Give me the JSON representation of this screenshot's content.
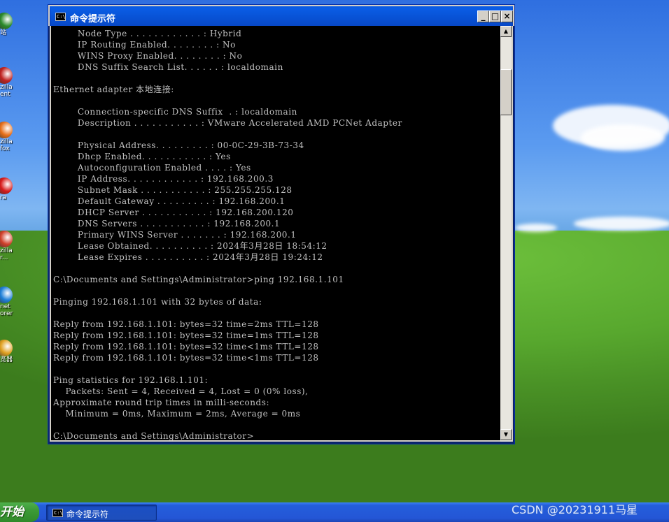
{
  "desktop": {
    "icons": [
      {
        "label": "站",
        "icon": "network-icon",
        "color": "#2a8a2a"
      },
      {
        "label": "zilla\nent",
        "icon": "filezilla-icon",
        "color": "#c0211f"
      },
      {
        "label": "zilla\nfox",
        "icon": "firefox-icon",
        "color": "#e8701a"
      },
      {
        "label": "ra",
        "icon": "opera-icon",
        "color": "#d81b1b"
      },
      {
        "label": "zilla\nr...",
        "icon": "filezilla-server-icon",
        "color": "#d0402a"
      },
      {
        "label": "net\norer",
        "icon": "internet-explorer-icon",
        "color": "#1e7fd8"
      },
      {
        "label": "览器",
        "icon": "chrome-icon",
        "color": "#e0a020"
      }
    ]
  },
  "window": {
    "title": "命令提示符",
    "icon_text": "C:\\",
    "controls": {
      "minimize": "_",
      "maximize": "□",
      "close": "×"
    }
  },
  "console": {
    "lines": [
      "        Node Type . . . . . . . . . . . . : Hybrid",
      "        IP Routing Enabled. . . . . . . . : No",
      "        WINS Proxy Enabled. . . . . . . . : No",
      "        DNS Suffix Search List. . . . . . : localdomain",
      "",
      "Ethernet adapter 本地连接:",
      "",
      "        Connection-specific DNS Suffix  . : localdomain",
      "        Description . . . . . . . . . . . : VMware Accelerated AMD PCNet Adapter",
      "",
      "        Physical Address. . . . . . . . . : 00-0C-29-3B-73-34",
      "        Dhcp Enabled. . . . . . . . . . . : Yes",
      "        Autoconfiguration Enabled . . . . : Yes",
      "        IP Address. . . . . . . . . . . . : 192.168.200.3",
      "        Subnet Mask . . . . . . . . . . . : 255.255.255.128",
      "        Default Gateway . . . . . . . . . : 192.168.200.1",
      "        DHCP Server . . . . . . . . . . . : 192.168.200.120",
      "        DNS Servers . . . . . . . . . . . : 192.168.200.1",
      "        Primary WINS Server . . . . . . . : 192.168.200.1",
      "        Lease Obtained. . . . . . . . . . : 2024年3月28日 18:54:12",
      "        Lease Expires . . . . . . . . . . : 2024年3月28日 19:24:12",
      "",
      "C:\\Documents and Settings\\Administrator>ping 192.168.1.101",
      "",
      "Pinging 192.168.1.101 with 32 bytes of data:",
      "",
      "Reply from 192.168.1.101: bytes=32 time=2ms TTL=128",
      "Reply from 192.168.1.101: bytes=32 time=1ms TTL=128",
      "Reply from 192.168.1.101: bytes=32 time<1ms TTL=128",
      "Reply from 192.168.1.101: bytes=32 time<1ms TTL=128",
      "",
      "Ping statistics for 192.168.1.101:",
      "    Packets: Sent = 4, Received = 4, Lost = 0 (0% loss),",
      "Approximate round trip times in milli-seconds:",
      "    Minimum = 0ms, Maximum = 2ms, Average = 0ms",
      "",
      "C:\\Documents and Settings\\Administrator>"
    ]
  },
  "scrollbar": {
    "up": "▲",
    "down": "▼"
  },
  "taskbar": {
    "start_label": "开始",
    "items": [
      {
        "label": "命令提示符",
        "icon_text": "C:\\"
      }
    ]
  },
  "watermark": "CSDN @20231911马星"
}
